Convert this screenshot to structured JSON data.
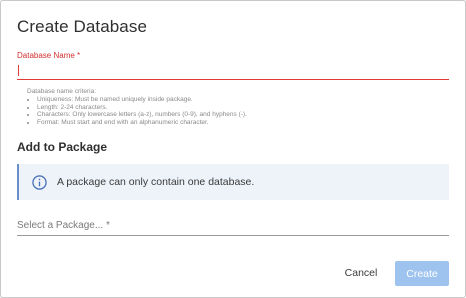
{
  "dialog": {
    "title": "Create Database"
  },
  "name_field": {
    "label": "Database Name *",
    "value": "",
    "placeholder": ""
  },
  "criteria": {
    "heading": "Database name criteria:",
    "items": [
      "Uniqueness: Must be named uniquely inside package.",
      "Length: 2-24 characters.",
      "Characters: Only lowercase letters (a-z), numbers (0-9), and hyphens (-).",
      "Format: Must start and end with an alphanumeric character."
    ]
  },
  "package_section": {
    "heading": "Add to Package",
    "info_text": "A package can only contain one database.",
    "select_placeholder": "Select a Package... *"
  },
  "actions": {
    "cancel_label": "Cancel",
    "create_label": "Create"
  },
  "colors": {
    "error": "#e53935",
    "info_background": "#eef3fa",
    "info_icon": "#4a72b8",
    "create_disabled": "#9ec3ee"
  },
  "icons": {
    "info": "info-circle-icon"
  }
}
